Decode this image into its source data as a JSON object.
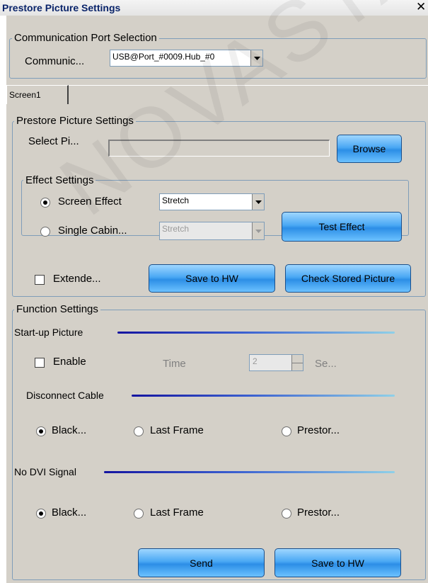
{
  "window": {
    "title": "Prestore Picture Settings"
  },
  "comm_port": {
    "group_label": "Communication Port Selection",
    "field_label": "Communic...",
    "selected": "USB@Port_#0009.Hub_#0"
  },
  "tabs": [
    {
      "label": "Screen1"
    }
  ],
  "prestore": {
    "group_label": "Prestore Picture Settings",
    "select_label": "Select Pi...",
    "path_value": "",
    "browse_label": "Browse",
    "effect": {
      "group_label": "Effect Settings",
      "screen_effect_label": "Screen Effect",
      "screen_effect_value": "Stretch",
      "single_cabinet_label": "Single Cabin...",
      "single_cabinet_value": "Stretch",
      "test_effect_label": "Test Effect"
    },
    "extended_label": "Extende...",
    "save_hw_label": "Save to HW",
    "check_stored_label": "Check Stored Picture"
  },
  "function": {
    "group_label": "Function Settings",
    "startup_label": "Start-up Picture",
    "enable_label": "Enable",
    "time_label": "Time",
    "time_value": "2",
    "time_unit": "Se...",
    "disconnect_label": "Disconnect Cable",
    "disconnect_options": [
      "Black...",
      "Last Frame",
      "Prestor..."
    ],
    "no_dvi_label": "No DVI Signal",
    "no_dvi_options": [
      "Black...",
      "Last Frame",
      "Prestor..."
    ],
    "send_label": "Send",
    "save_hw_label": "Save to HW"
  },
  "watermark": "NOVASTAR TEC",
  "colors": {
    "accent_line": "#1414a0",
    "button_blue": "#4aa8f4",
    "dialog_bg": "#d4d0c8"
  }
}
